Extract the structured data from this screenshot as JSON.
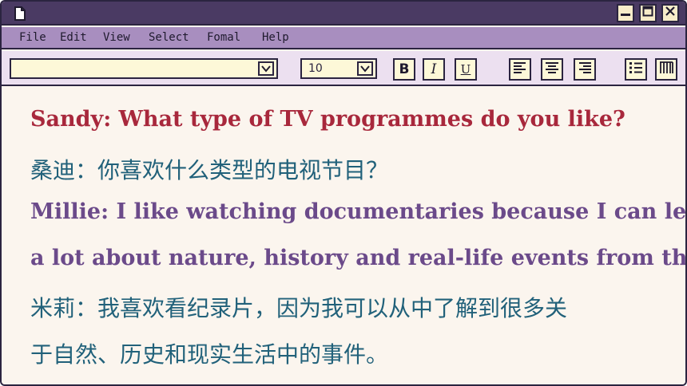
{
  "window": {
    "icons": {
      "document": "document-icon",
      "minimize": "minimize-icon",
      "maximize": "maximize-icon",
      "close": "close-icon"
    }
  },
  "menu": {
    "items": [
      {
        "label": "File"
      },
      {
        "label": "Edit"
      },
      {
        "label": "View"
      },
      {
        "label": "Select"
      },
      {
        "label": "Fomal"
      },
      {
        "label": "Help"
      }
    ]
  },
  "toolbar": {
    "font_value": "",
    "size_value": "10",
    "bold_label": "B",
    "italic_label": "I",
    "underline_label": "U",
    "icons": [
      "align-left-icon",
      "align-center-icon",
      "align-right-icon",
      "bulleted-list-icon",
      "columns-icon"
    ]
  },
  "content": {
    "lines": [
      "Sandy: What type of TV programmes do you like?",
      "桑迪：你喜欢什么类型的电视节目？",
      "Millie: I like watching documentaries because I can learn",
      "a lot about nature, history and real-life events from them.",
      "米莉：我喜欢看纪录片，因为我可以从中了解到很多关",
      "于自然、历史和现实生活中的事件。"
    ]
  },
  "colors": {
    "titlebar": "#4a3a63",
    "menubar": "#a88ebf",
    "toolbar": "#ece0f0",
    "field": "#fdf8d8",
    "page": "#fbf5ee",
    "english_question": "#a8283c",
    "english_answer": "#6b4a8a",
    "chinese": "#21617a"
  }
}
